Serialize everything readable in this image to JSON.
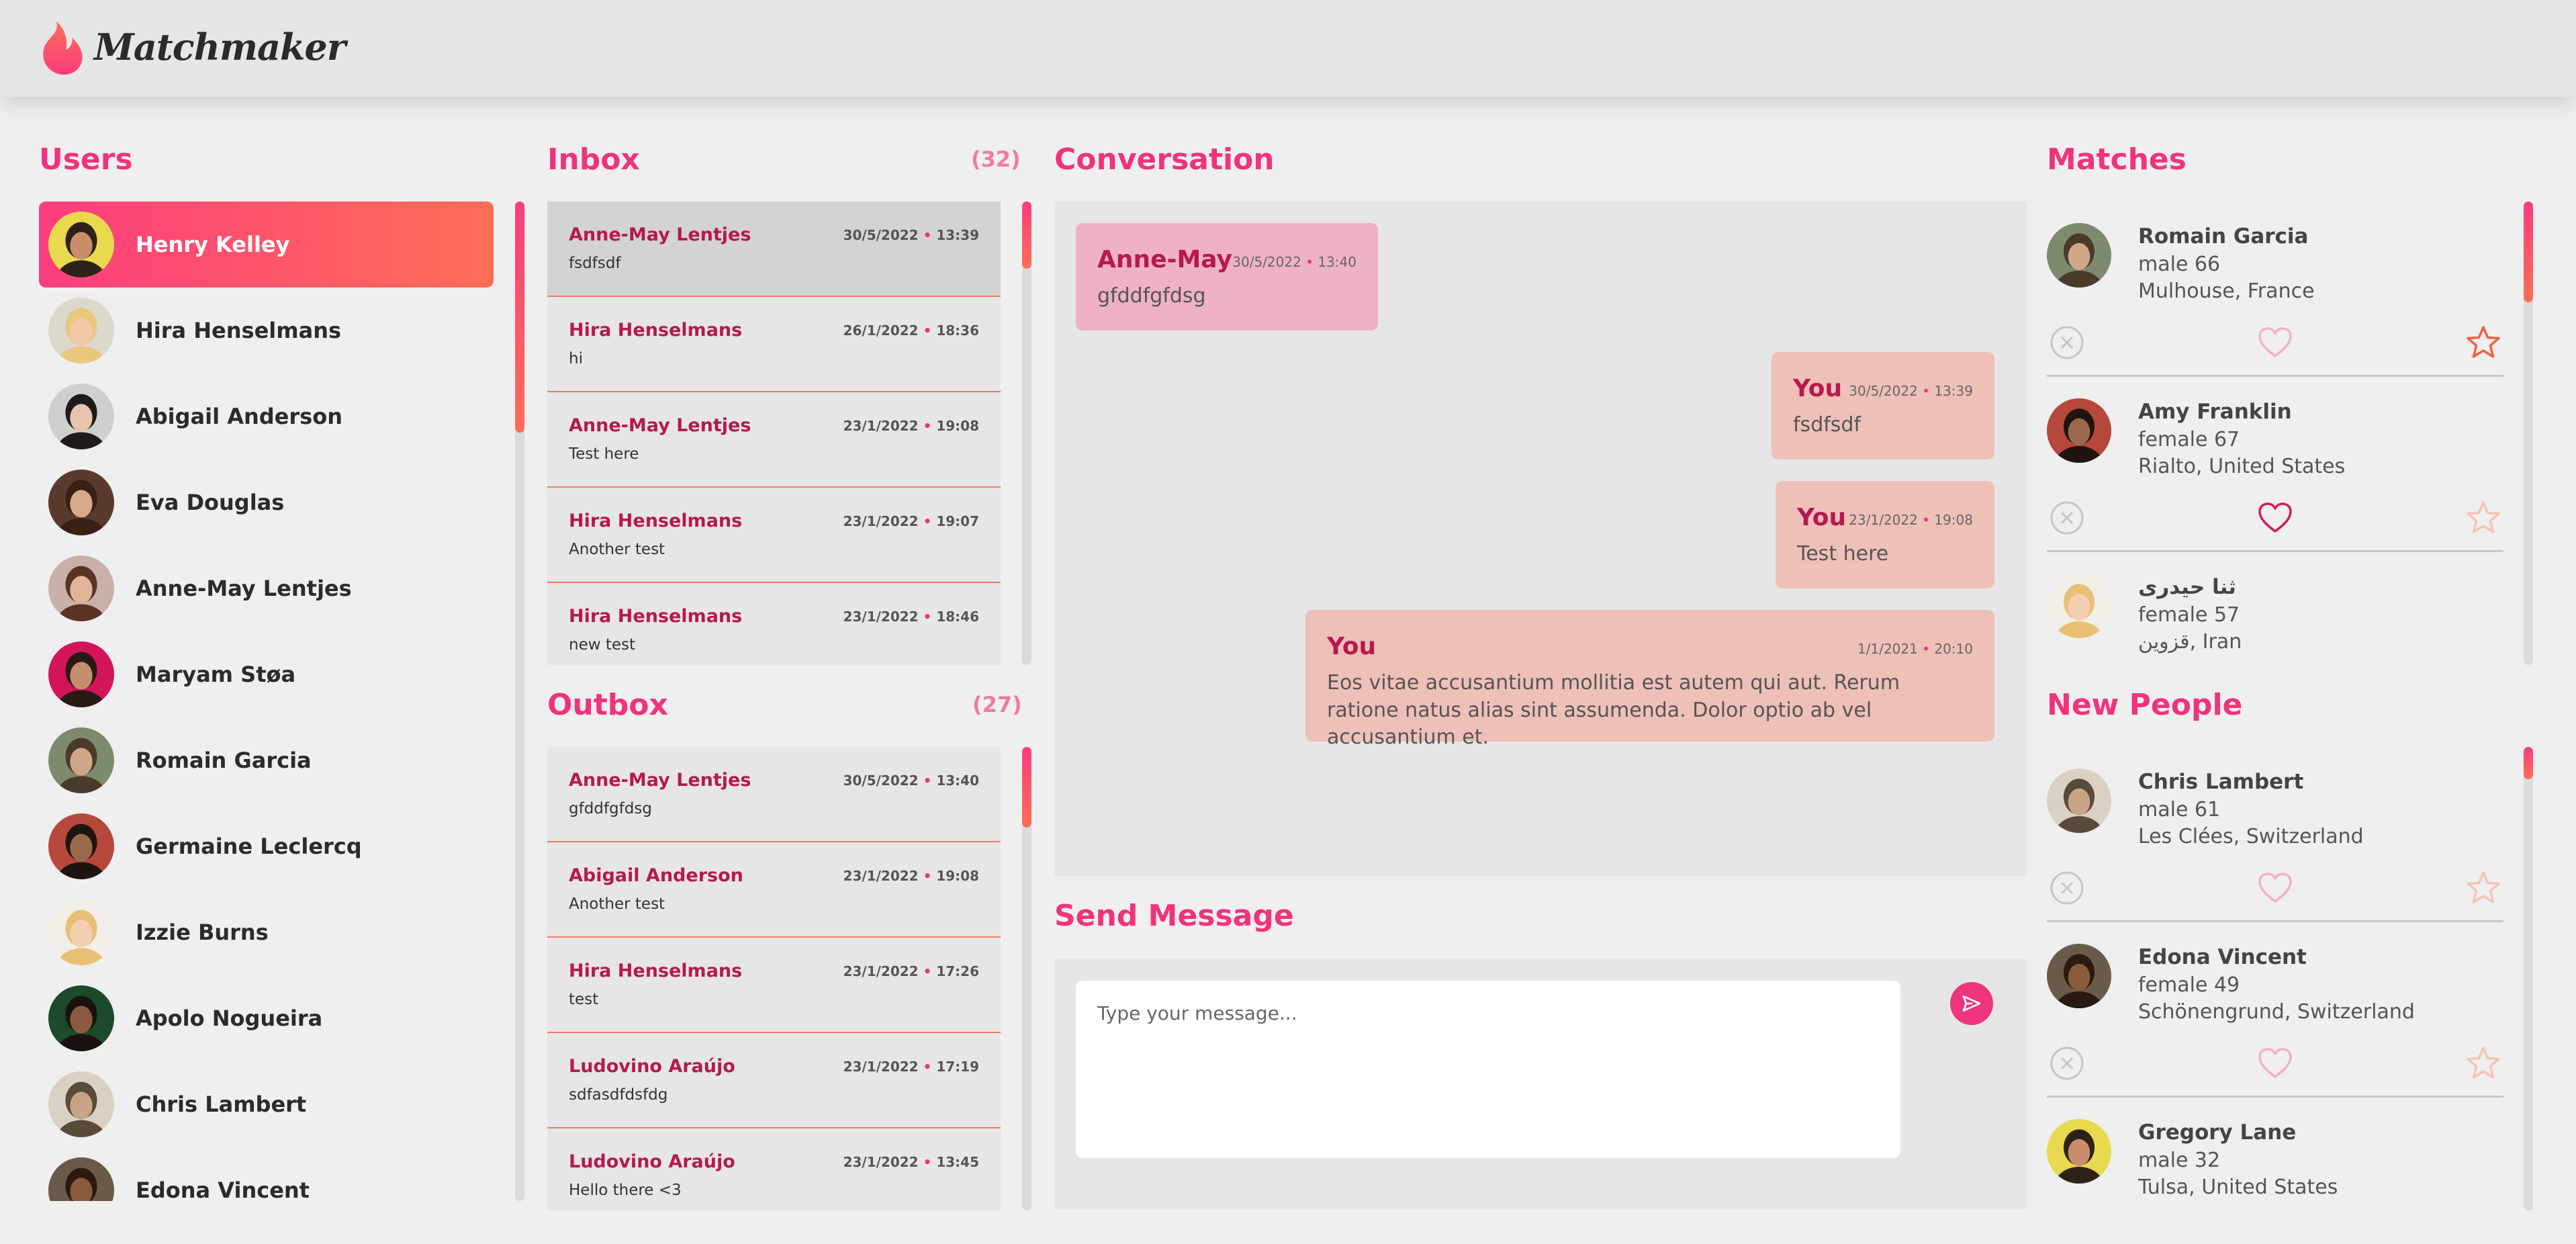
{
  "app": {
    "title": "Matchmaker"
  },
  "colors": {
    "accent": "#f0337d",
    "accent_alt": "#ff6e57",
    "name": "#b5194f"
  },
  "users": {
    "title": "Users",
    "items": [
      {
        "name": "Henry Kelley",
        "active": true
      },
      {
        "name": "Hira Henselmans"
      },
      {
        "name": "Abigail Anderson"
      },
      {
        "name": "Eva Douglas"
      },
      {
        "name": "Anne-May Lentjes"
      },
      {
        "name": "Maryam Støa"
      },
      {
        "name": "Romain Garcia"
      },
      {
        "name": "Germaine Leclercq"
      },
      {
        "name": "Izzie Burns"
      },
      {
        "name": "Apolo Nogueira"
      },
      {
        "name": "Chris Lambert"
      },
      {
        "name": "Edona Vincent"
      }
    ]
  },
  "inbox": {
    "title": "Inbox",
    "count": "(32)",
    "items": [
      {
        "name": "Anne-May Lentjes",
        "date": "30/5/2022",
        "time": "13:39",
        "text": "fsdfsdf"
      },
      {
        "name": "Hira Henselmans",
        "date": "26/1/2022",
        "time": "18:36",
        "text": "hi"
      },
      {
        "name": "Anne-May Lentjes",
        "date": "23/1/2022",
        "time": "19:08",
        "text": "Test here"
      },
      {
        "name": "Hira Henselmans",
        "date": "23/1/2022",
        "time": "19:07",
        "text": "Another test"
      },
      {
        "name": "Hira Henselmans",
        "date": "23/1/2022",
        "time": "18:46",
        "text": "new test"
      }
    ]
  },
  "outbox": {
    "title": "Outbox",
    "count": "(27)",
    "items": [
      {
        "name": "Anne-May Lentjes",
        "date": "30/5/2022",
        "time": "13:40",
        "text": "gfddfgfdsg"
      },
      {
        "name": "Abigail Anderson",
        "date": "23/1/2022",
        "time": "19:08",
        "text": "Another test"
      },
      {
        "name": "Hira Henselmans",
        "date": "23/1/2022",
        "time": "17:26",
        "text": "test"
      },
      {
        "name": "Ludovino Araújo",
        "date": "23/1/2022",
        "time": "17:19",
        "text": "sdfasdfdsfdg"
      },
      {
        "name": "Ludovino Araújo",
        "date": "23/1/2022",
        "time": "13:45",
        "text": "Hello there <3"
      }
    ]
  },
  "conversation": {
    "title": "Conversation",
    "messages": [
      {
        "from": "Anne-May",
        "date": "30/5/2022",
        "time": "13:40",
        "text": "gfddfgfdsg"
      },
      {
        "from": "You",
        "date": "30/5/2022",
        "time": "13:39",
        "text": "fsdfsdf"
      },
      {
        "from": "You",
        "date": "23/1/2022",
        "time": "19:08",
        "text": "Test here"
      },
      {
        "from": "You",
        "date": "1/1/2021",
        "time": "20:10",
        "text": "Eos vitae accusantium mollitia est autem qui aut. Rerum ratione natus alias sint assumenda. Dolor optio ab vel accusantium et."
      }
    ]
  },
  "send": {
    "title": "Send Message",
    "placeholder": "Type your message...",
    "value": ""
  },
  "matches": {
    "title": "Matches",
    "items": [
      {
        "name": "Romain Garcia",
        "gender_age": "male 66",
        "location": "Mulhouse, France",
        "liked": false,
        "starred": true
      },
      {
        "name": "Amy Franklin",
        "gender_age": "female 67",
        "location": "Rialto, United States",
        "liked": true,
        "starred": false
      },
      {
        "name": "ثنا حیدری",
        "gender_age": "female 57",
        "location": "قزوین, Iran",
        "liked": false,
        "starred": false
      }
    ]
  },
  "new_people": {
    "title": "New People",
    "items": [
      {
        "name": "Chris Lambert",
        "gender_age": "male 61",
        "location": "Les Clées, Switzerland",
        "liked": false,
        "starred": false
      },
      {
        "name": "Edona Vincent",
        "gender_age": "female 49",
        "location": "Schönengrund, Switzerland",
        "liked": false,
        "starred": false
      },
      {
        "name": "Gregory Lane",
        "gender_age": "male 32",
        "location": "Tulsa, United States",
        "liked": false,
        "starred": false
      }
    ]
  }
}
